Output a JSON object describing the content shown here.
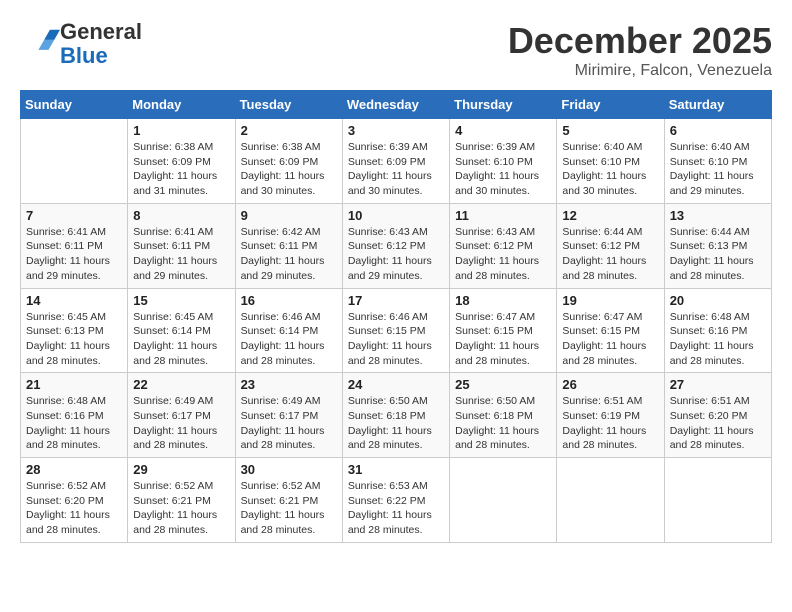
{
  "header": {
    "logo_line1": "General",
    "logo_line2": "Blue",
    "month_title": "December 2025",
    "location": "Mirimire, Falcon, Venezuela"
  },
  "days_of_week": [
    "Sunday",
    "Monday",
    "Tuesday",
    "Wednesday",
    "Thursday",
    "Friday",
    "Saturday"
  ],
  "weeks": [
    [
      {
        "day": "",
        "info": ""
      },
      {
        "day": "1",
        "info": "Sunrise: 6:38 AM\nSunset: 6:09 PM\nDaylight: 11 hours\nand 31 minutes."
      },
      {
        "day": "2",
        "info": "Sunrise: 6:38 AM\nSunset: 6:09 PM\nDaylight: 11 hours\nand 30 minutes."
      },
      {
        "day": "3",
        "info": "Sunrise: 6:39 AM\nSunset: 6:09 PM\nDaylight: 11 hours\nand 30 minutes."
      },
      {
        "day": "4",
        "info": "Sunrise: 6:39 AM\nSunset: 6:10 PM\nDaylight: 11 hours\nand 30 minutes."
      },
      {
        "day": "5",
        "info": "Sunrise: 6:40 AM\nSunset: 6:10 PM\nDaylight: 11 hours\nand 30 minutes."
      },
      {
        "day": "6",
        "info": "Sunrise: 6:40 AM\nSunset: 6:10 PM\nDaylight: 11 hours\nand 29 minutes."
      }
    ],
    [
      {
        "day": "7",
        "info": "Sunrise: 6:41 AM\nSunset: 6:11 PM\nDaylight: 11 hours\nand 29 minutes."
      },
      {
        "day": "8",
        "info": "Sunrise: 6:41 AM\nSunset: 6:11 PM\nDaylight: 11 hours\nand 29 minutes."
      },
      {
        "day": "9",
        "info": "Sunrise: 6:42 AM\nSunset: 6:11 PM\nDaylight: 11 hours\nand 29 minutes."
      },
      {
        "day": "10",
        "info": "Sunrise: 6:43 AM\nSunset: 6:12 PM\nDaylight: 11 hours\nand 29 minutes."
      },
      {
        "day": "11",
        "info": "Sunrise: 6:43 AM\nSunset: 6:12 PM\nDaylight: 11 hours\nand 28 minutes."
      },
      {
        "day": "12",
        "info": "Sunrise: 6:44 AM\nSunset: 6:12 PM\nDaylight: 11 hours\nand 28 minutes."
      },
      {
        "day": "13",
        "info": "Sunrise: 6:44 AM\nSunset: 6:13 PM\nDaylight: 11 hours\nand 28 minutes."
      }
    ],
    [
      {
        "day": "14",
        "info": "Sunrise: 6:45 AM\nSunset: 6:13 PM\nDaylight: 11 hours\nand 28 minutes."
      },
      {
        "day": "15",
        "info": "Sunrise: 6:45 AM\nSunset: 6:14 PM\nDaylight: 11 hours\nand 28 minutes."
      },
      {
        "day": "16",
        "info": "Sunrise: 6:46 AM\nSunset: 6:14 PM\nDaylight: 11 hours\nand 28 minutes."
      },
      {
        "day": "17",
        "info": "Sunrise: 6:46 AM\nSunset: 6:15 PM\nDaylight: 11 hours\nand 28 minutes."
      },
      {
        "day": "18",
        "info": "Sunrise: 6:47 AM\nSunset: 6:15 PM\nDaylight: 11 hours\nand 28 minutes."
      },
      {
        "day": "19",
        "info": "Sunrise: 6:47 AM\nSunset: 6:15 PM\nDaylight: 11 hours\nand 28 minutes."
      },
      {
        "day": "20",
        "info": "Sunrise: 6:48 AM\nSunset: 6:16 PM\nDaylight: 11 hours\nand 28 minutes."
      }
    ],
    [
      {
        "day": "21",
        "info": "Sunrise: 6:48 AM\nSunset: 6:16 PM\nDaylight: 11 hours\nand 28 minutes."
      },
      {
        "day": "22",
        "info": "Sunrise: 6:49 AM\nSunset: 6:17 PM\nDaylight: 11 hours\nand 28 minutes."
      },
      {
        "day": "23",
        "info": "Sunrise: 6:49 AM\nSunset: 6:17 PM\nDaylight: 11 hours\nand 28 minutes."
      },
      {
        "day": "24",
        "info": "Sunrise: 6:50 AM\nSunset: 6:18 PM\nDaylight: 11 hours\nand 28 minutes."
      },
      {
        "day": "25",
        "info": "Sunrise: 6:50 AM\nSunset: 6:18 PM\nDaylight: 11 hours\nand 28 minutes."
      },
      {
        "day": "26",
        "info": "Sunrise: 6:51 AM\nSunset: 6:19 PM\nDaylight: 11 hours\nand 28 minutes."
      },
      {
        "day": "27",
        "info": "Sunrise: 6:51 AM\nSunset: 6:20 PM\nDaylight: 11 hours\nand 28 minutes."
      }
    ],
    [
      {
        "day": "28",
        "info": "Sunrise: 6:52 AM\nSunset: 6:20 PM\nDaylight: 11 hours\nand 28 minutes."
      },
      {
        "day": "29",
        "info": "Sunrise: 6:52 AM\nSunset: 6:21 PM\nDaylight: 11 hours\nand 28 minutes."
      },
      {
        "day": "30",
        "info": "Sunrise: 6:52 AM\nSunset: 6:21 PM\nDaylight: 11 hours\nand 28 minutes."
      },
      {
        "day": "31",
        "info": "Sunrise: 6:53 AM\nSunset: 6:22 PM\nDaylight: 11 hours\nand 28 minutes."
      },
      {
        "day": "",
        "info": ""
      },
      {
        "day": "",
        "info": ""
      },
      {
        "day": "",
        "info": ""
      }
    ]
  ]
}
